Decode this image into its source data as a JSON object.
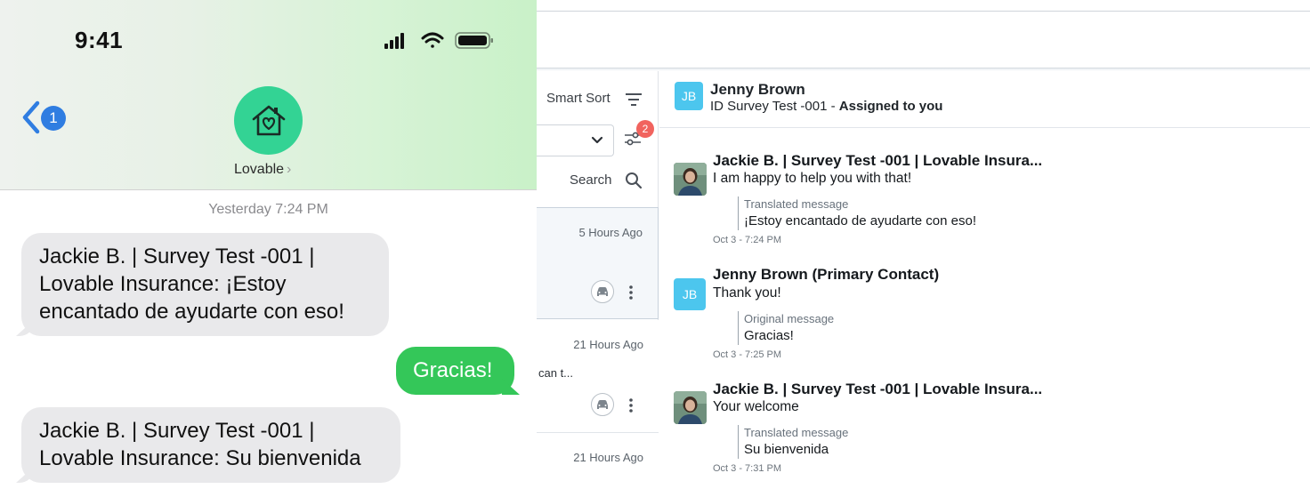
{
  "phone": {
    "status_time": "9:41",
    "back_badge": "1",
    "contact_name": "Lovable",
    "contact_chevron": "›",
    "timestamp_day": "Yesterday",
    "timestamp_time": "7:24 PM",
    "messages": [
      {
        "direction": "incoming",
        "lines": [
          "Jackie B. | Survey Test -001 |",
          "Lovable Insurance: ¡Estoy",
          "encantado de ayudarte con eso!"
        ]
      },
      {
        "direction": "outgoing",
        "lines": [
          "Gracias!"
        ]
      },
      {
        "direction": "incoming",
        "lines": [
          "Jackie B. | Survey Test -001 |",
          "Lovable Insurance: Su bienvenida"
        ]
      }
    ],
    "colors": {
      "incoming": "#e9e9eb",
      "outgoing": "#34c759",
      "avatar": "#33d394",
      "badge": "#2f7de1"
    }
  },
  "list": {
    "smart_sort": "Smart Sort",
    "filter_badge": "2",
    "search_label": "Search",
    "items": [
      {
        "time": "5 Hours Ago",
        "snippet": ""
      },
      {
        "time": "21 Hours Ago",
        "snippet": "can t..."
      },
      {
        "time": "21 Hours Ago",
        "snippet": ""
      }
    ]
  },
  "thread": {
    "header": {
      "initials": "JB",
      "name": "Jenny Brown",
      "sub_prefix": "ID Survey Test -001 - ",
      "sub_bold": "Assigned to you"
    },
    "messages": [
      {
        "sender": "Jackie B. | Survey Test -001 | Lovable Insura...",
        "text": "I am happy to help you with that!",
        "quote_label": "Translated message",
        "quote_text": "¡Estoy encantado de ayudarte con eso!",
        "date": "Oct 3 - 7:24 PM"
      },
      {
        "sender": "Jenny Brown (Primary Contact)",
        "avatar_initials": "JB",
        "text": "Thank you!",
        "quote_label": "Original message",
        "quote_text": "Gracias!",
        "date": "Oct 3 - 7:25 PM"
      },
      {
        "sender": "Jackie B. | Survey Test -001 | Lovable Insura...",
        "text": "Your welcome",
        "quote_label": "Translated message",
        "quote_text": "Su bienvenida",
        "date": "Oct 3 - 7:31 PM"
      }
    ],
    "colors": {
      "jb_avatar": "#4cc6ee",
      "filter_badge": "#f1635e"
    }
  }
}
